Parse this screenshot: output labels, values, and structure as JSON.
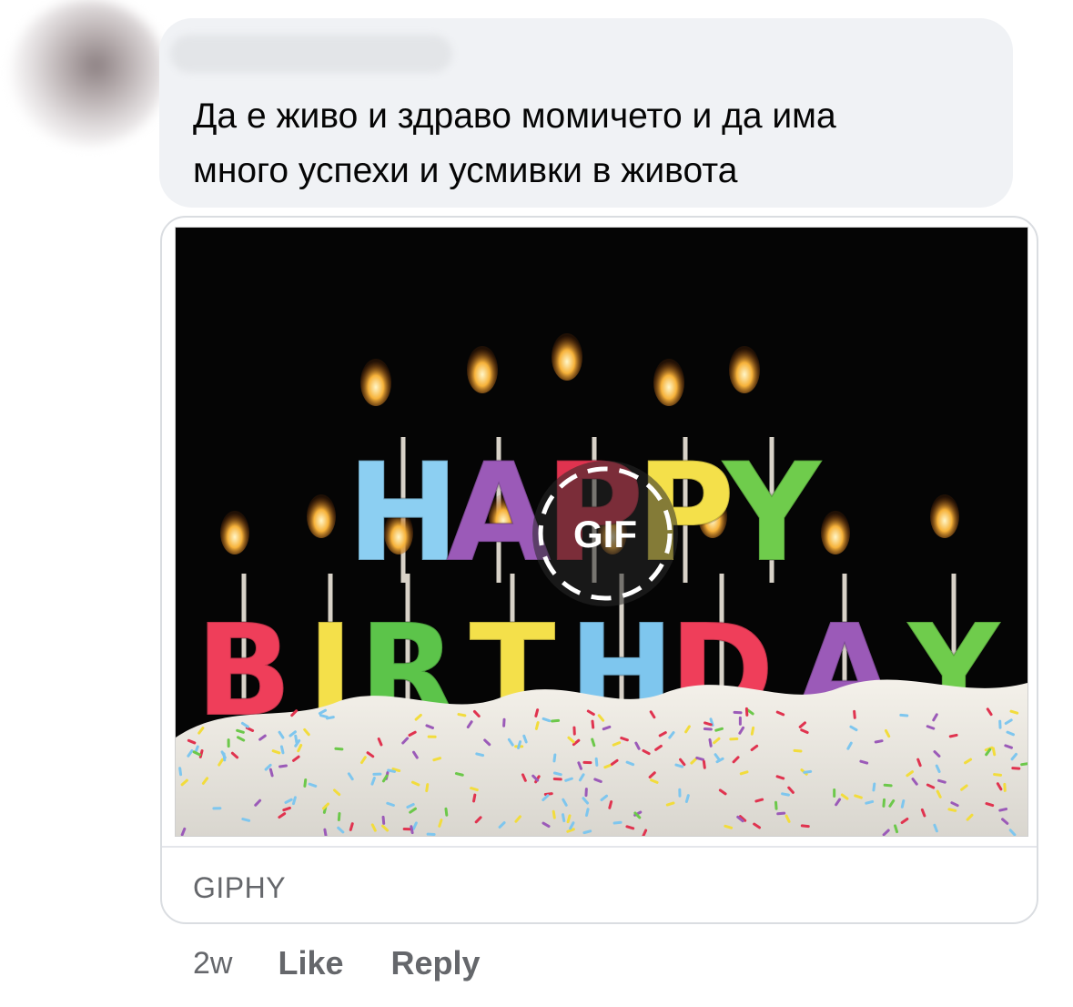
{
  "comment": {
    "text": "Да е живо и здраво момичето и да има\nмного успехи и усмивки в живота",
    "attachment": {
      "gif_badge": "GIF",
      "source": "GIPHY",
      "picture_letters": {
        "top_word": [
          "H",
          "A",
          "P",
          "P",
          "Y"
        ],
        "bottom_word": [
          "B",
          "I",
          "R",
          "T",
          "H",
          "D",
          "A",
          "Y"
        ]
      }
    },
    "timestamp": "2w",
    "actions": {
      "like": "Like",
      "reply": "Reply"
    }
  },
  "colors": {
    "bubble": "#f0f2f5",
    "meta_text": "#65676b",
    "body_text": "#050505",
    "card_border": "#dadde1"
  }
}
